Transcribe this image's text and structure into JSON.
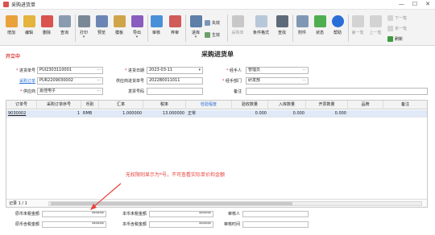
{
  "window": {
    "title": "采购进货单"
  },
  "toolbar": {
    "buttons": [
      {
        "label": "增加"
      },
      {
        "label": "编辑"
      },
      {
        "label": "删除"
      },
      {
        "label": "查询"
      },
      {
        "label": "打印"
      },
      {
        "label": "预览"
      },
      {
        "label": "模板"
      },
      {
        "label": "导出"
      },
      {
        "label": "审核"
      },
      {
        "label": "弃审"
      },
      {
        "label": "进库"
      },
      {
        "label": "失效"
      },
      {
        "label": "生效"
      },
      {
        "label": "采购单"
      },
      {
        "label": "条件格式"
      },
      {
        "label": "查找"
      },
      {
        "label": "附件"
      },
      {
        "label": "状态"
      },
      {
        "label": "帮助"
      },
      {
        "label": "第一笔"
      },
      {
        "label": "上一笔"
      },
      {
        "label": "下一笔"
      },
      {
        "label": "末一笔"
      },
      {
        "label": "刷新"
      }
    ]
  },
  "header": {
    "status": "开立中",
    "title": "采购进货单"
  },
  "form": {
    "doc_no_label": "进货单号",
    "doc_no": "PUI2303110001",
    "date_label": "进货日期",
    "date": "2023-03-11",
    "handler_label": "经手人",
    "handler": "管理员",
    "po_link": "采购订单",
    "po_no": "PUR2209030002",
    "supplier_doc_label": "供应商进货单号",
    "supplier_doc": "2022B0011011",
    "dept_label": "经手部门",
    "dept": "研发部",
    "supplier_label": "供应商",
    "supplier": "嘉佳电子",
    "invoice_label": "发票号码",
    "invoice": "",
    "remark_label": "备注",
    "remark": ""
  },
  "grid": {
    "columns": [
      "订单号",
      "采购订单序号",
      "币别",
      "汇率",
      "税率",
      "检验程度",
      "验收数量",
      "入库数量",
      "开票数量",
      "品牌",
      "备注"
    ],
    "rows": [
      {
        "order_no": "9030002",
        "seq": "1",
        "currency": "RMB",
        "rate": "1.000000",
        "tax": "13.000000",
        "inspect": "正常",
        "accept": "0.000",
        "stock": "0.000",
        "invoice": "0.000",
        "brand": "",
        "remark": ""
      }
    ],
    "record_count": "记录 1 / 1"
  },
  "annotation": "无权限则显示为*号，不可查看实际单价和金额",
  "totals": {
    "l1": "原币未税金额",
    "v1": "******",
    "l2": "本币未税金额",
    "v2": "******",
    "l3": "审核人",
    "v3": "",
    "l4": "原币含税金额",
    "v4": "******",
    "l5": "本币含税金额",
    "v5": "******",
    "l6": "审核时间",
    "v6": ""
  },
  "colors": {
    "accent": "#2a6fd8",
    "required": "#d33333",
    "annotation": "#e8423a",
    "selected_row": "#dfe9f7"
  }
}
